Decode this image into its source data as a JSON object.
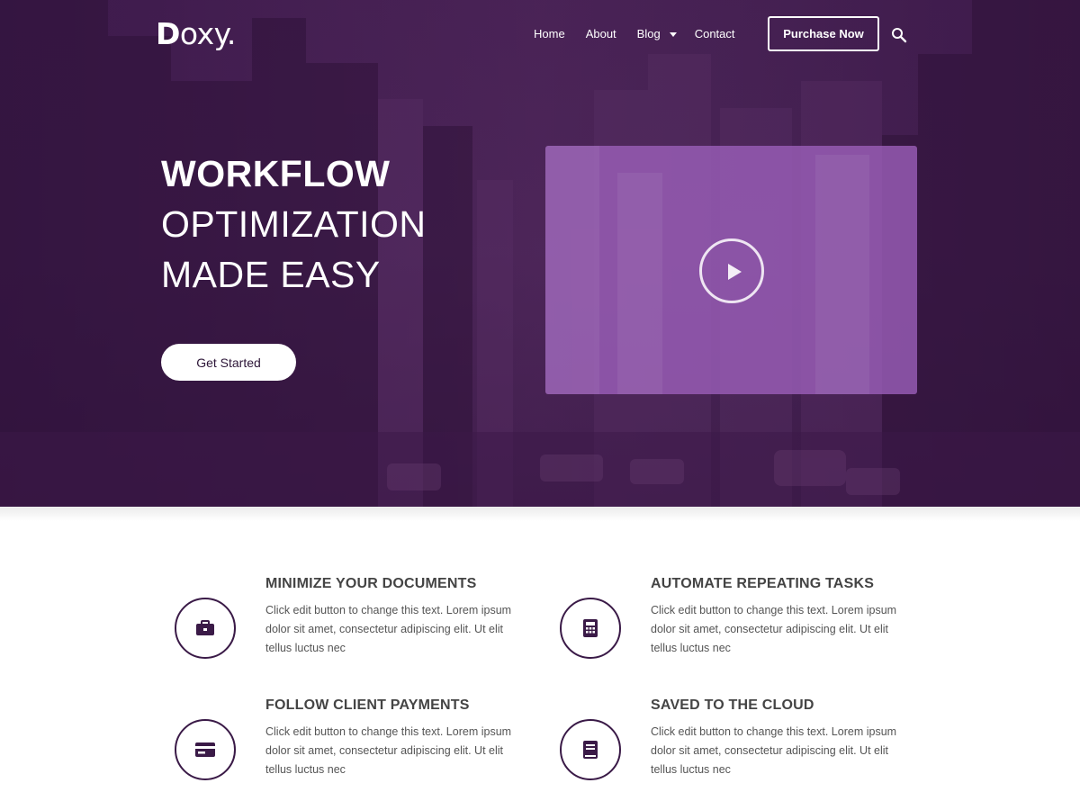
{
  "brand": {
    "logo_bold": "D",
    "logo_rest": "oxy."
  },
  "nav": {
    "items": [
      {
        "label": "Home"
      },
      {
        "label": "About"
      },
      {
        "label": "Blog"
      },
      {
        "label": "Contact"
      }
    ],
    "purchase_label": "Purchase Now"
  },
  "hero": {
    "line1": "WORKFLOW",
    "line2": "OPTIMIZATION",
    "line3": "MADE EASY",
    "cta_label": "Get Started"
  },
  "features": [
    {
      "title": "MINIMIZE YOUR DOCUMENTS",
      "text": "Click edit button to change this text. Lorem ipsum dolor sit amet, consectetur adipiscing elit. Ut elit tellus luctus nec",
      "icon": "briefcase-icon"
    },
    {
      "title": "AUTOMATE REPEATING TASKS",
      "text": "Click edit button to change this text. Lorem ipsum dolor sit amet, consectetur adipiscing elit. Ut elit tellus luctus nec",
      "icon": "calculator-icon"
    },
    {
      "title": "FOLLOW CLIENT PAYMENTS",
      "text": "Click edit button to change this text. Lorem ipsum dolor sit amet, consectetur adipiscing elit. Ut elit tellus luctus nec",
      "icon": "credit-card-icon"
    },
    {
      "title": "SAVED TO THE CLOUD",
      "text": "Click edit button to change this text. Lorem ipsum dolor sit amet, consectetur adipiscing elit. Ut elit tellus luctus nec",
      "icon": "book-icon"
    }
  ],
  "colors": {
    "hero_overlay": "#3d1a4c",
    "video_panel": "#9b5fb9",
    "icon_stroke": "#3a1a47"
  }
}
